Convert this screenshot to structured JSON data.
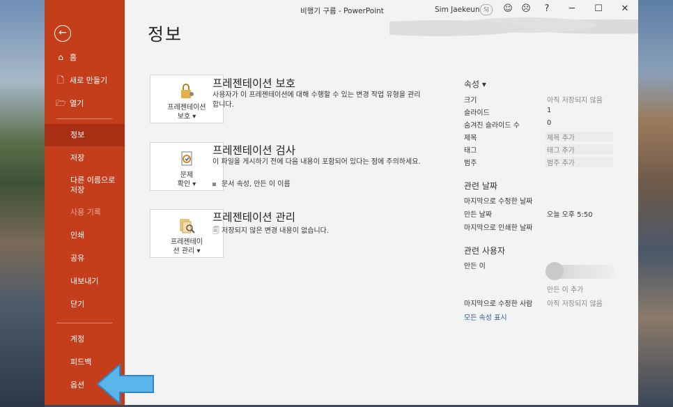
{
  "window": {
    "doc_title": "비행기 구름  -  PowerPoint",
    "user_name": "Sim Jaekeun",
    "user_initials": "SJ"
  },
  "titlebar_buttons": [
    "smile-icon",
    "frown-icon",
    "?",
    "─",
    "☐",
    "✕"
  ],
  "sidebar": {
    "back_icon": "←",
    "top_items": [
      {
        "icon": "home-icon",
        "label": "홈"
      },
      {
        "icon": "new-file-icon",
        "label": "새로 만들기"
      },
      {
        "icon": "open-folder-icon",
        "label": "열기"
      }
    ],
    "info": "정보",
    "save": "저장",
    "save_as": "다른 이름으로 저장",
    "history": "사용 기록",
    "print": "인쇄",
    "share": "공유",
    "export": "내보내기",
    "close": "닫기",
    "account": "계정",
    "feedback": "피드백",
    "options": "옵션"
  },
  "main": {
    "title": "정보",
    "sections": [
      {
        "card_label_1": "프레젠테이션",
        "card_label_2": "보호 ▾",
        "title": "프레젠테이션 보호",
        "desc": "사용자가 이 프레젠테이션에 대해 수행할 수 있는 변경 작업 유형을 관리합니다."
      },
      {
        "card_label_1": "문제",
        "card_label_2": "확인 ▾",
        "title": "프레젠테이션 검사",
        "desc": "이 파일을 게시하기 전에 다음 내용이 포함되어 있다는 점에 주의하세요.",
        "bullet": "문서 속성, 만든 이 이름"
      },
      {
        "card_label_1": "프레젠테이",
        "card_label_2": "션 관리 ▾",
        "title": "프레젠테이션 관리",
        "desc": "저장되지 않은 변경 내용이 없습니다."
      }
    ]
  },
  "properties": {
    "header": "속성 ▾",
    "rows": [
      {
        "key": "크기",
        "value": "아직 저장되지 않음"
      },
      {
        "key": "슬라이드",
        "value": "1"
      },
      {
        "key": "숨겨진 슬라이드 수",
        "value": "0"
      },
      {
        "key": "제목",
        "value": "제목 추가"
      },
      {
        "key": "태그",
        "value": "태그 추가"
      },
      {
        "key": "범주",
        "value": "범주 추가"
      }
    ],
    "dates_header": "관련 날짜",
    "modified": "마지막으로 수정한 날짜",
    "created_key": "만든 날짜",
    "created_value": "오늘 오후 5:50",
    "printed": "마지막으로 인쇄한 날짜",
    "people_header": "관련 사용자",
    "author_key": "만든 이",
    "add_author": "만든 이 추가",
    "last_modified_by_key": "마지막으로 수정한 사람",
    "last_modified_by_value": "아직 저장되지 않음",
    "show_all": "모든 속성 표시"
  }
}
